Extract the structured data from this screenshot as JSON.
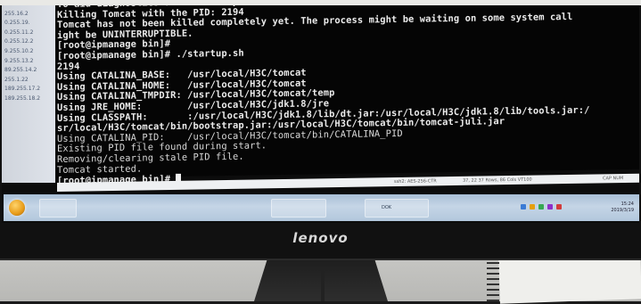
{
  "colors": {
    "terminal_bg": "#050505",
    "terminal_fg": "#ececec",
    "taskbar": "#b2c7dc",
    "bezel": "#111111"
  },
  "sidebar": {
    "items": [
      "0.255.15.2",
      "255.16.2",
      "0.255.19.",
      "0.255.11.2",
      "0.255.12.2",
      "9.255.10.2",
      "9.255.13.2",
      "89.255.14.2",
      "255.1.22",
      "189.255.17.2",
      "189.255.18.2"
    ]
  },
  "terminal": {
    "lines": [
      "To aid diagnostics a thread dump has been written to standard out.",
      "Killing Tomcat with the PID: 2194",
      "Tomcat has not been killed completely yet. The process might be waiting on some system call",
      "ight be UNINTERRUPTIBLE.",
      "[root@ipmanage bin]#",
      "[root@ipmanage bin]# ./startup.sh",
      "2194",
      "Using CATALINA_BASE:   /usr/local/H3C/tomcat",
      "Using CATALINA_HOME:   /usr/local/H3C/tomcat",
      "Using CATALINA_TMPDIR: /usr/local/H3C/tomcat/temp",
      "Using JRE_HOME:        /usr/local/H3C/jdk1.8/jre",
      "Using CLASSPATH:       :/usr/local/H3C/jdk1.8/lib/dt.jar:/usr/local/H3C/jdk1.8/lib/tools.jar:/",
      "sr/local/H3C/tomcat/bin/bootstrap.jar:/usr/local/H3C/tomcat/bin/tomcat-juli.jar",
      "Using CATALINA_PID:    /usr/local/H3C/tomcat/bin/CATALINA_PID",
      "Existing PID file found during start.",
      "Removing/clearing stale PID file.",
      "Tomcat started.",
      "[root@ipmanage bin]# "
    ]
  },
  "status_bar": {
    "ssh": "ssh2: AES-256-CTR",
    "position": "37, 22  37 Rows, 86 Cols  VT100",
    "caps": "CAP NUM"
  },
  "taskbar": {
    "item1": "DOK",
    "clock_time": "15:24",
    "clock_date": "2019/3/19"
  },
  "brand": "lenovo"
}
